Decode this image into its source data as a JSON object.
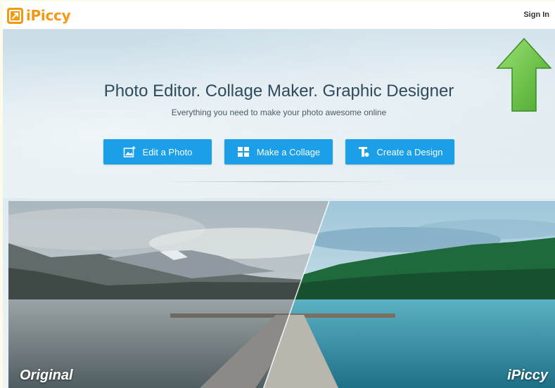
{
  "header": {
    "logo_text": "iPiccy",
    "signin_label": "Sign In"
  },
  "hero": {
    "headline": "Photo Editor. Collage Maker. Graphic Designer",
    "subline": "Everything you need to make your photo awesome online"
  },
  "actions": [
    {
      "label": "Edit a Photo",
      "icon": "photo-edit-icon"
    },
    {
      "label": "Make a Collage",
      "icon": "collage-grid-icon"
    },
    {
      "label": "Create a Design",
      "icon": "design-text-icon"
    }
  ],
  "comparison": {
    "left_label": "Original",
    "right_label": "iPiccy"
  },
  "colors": {
    "brand": "#f39a13",
    "button": "#1a9fe8",
    "annotation_arrow": "#6cc24a"
  }
}
